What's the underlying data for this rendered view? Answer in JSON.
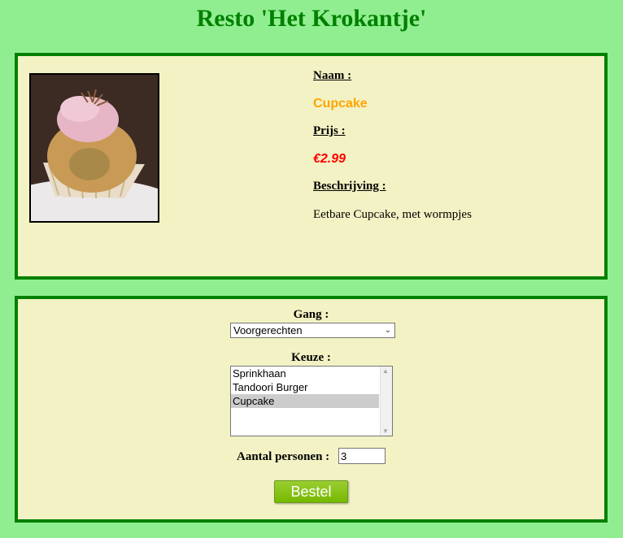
{
  "title": "Resto 'Het Krokantje'",
  "product": {
    "image_icon": "cupcake-photo",
    "name_label": "Naam :",
    "name": "Cupcake",
    "price_label": "Prijs :",
    "price": "€2.99",
    "description_label": "Beschrijving :",
    "description": "Eetbare Cupcake, met wormpjes"
  },
  "order": {
    "gang_label": "Gang :",
    "gang_selected": "Voorgerechten",
    "keuze_label": "Keuze :",
    "keuze_options": [
      "Sprinkhaan",
      "Tandoori Burger",
      "Cupcake"
    ],
    "keuze_selected": "Cupcake",
    "persons_label": "Aantal personen :",
    "persons_value": "3",
    "submit_label": "Bestel"
  },
  "colors": {
    "background": "#90EE90",
    "panel": "#F2F2C4",
    "border": "#008000",
    "name": "#FFA500",
    "price": "#FF0000"
  }
}
